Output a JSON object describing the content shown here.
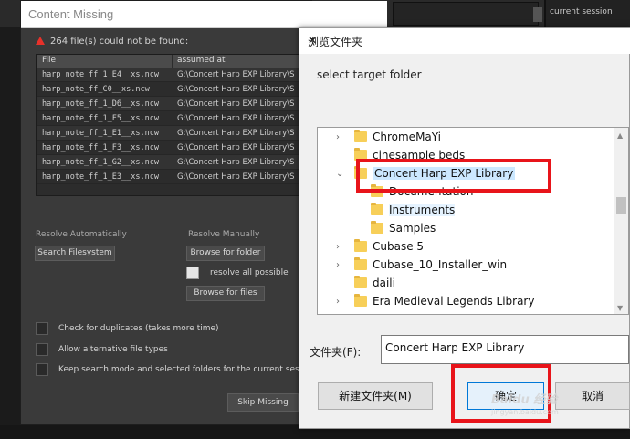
{
  "background": {
    "session_label": "current session"
  },
  "content_missing": {
    "title": "Content Missing",
    "alert_text": "264 file(s) could not be found:",
    "columns": [
      "File",
      "assumed at"
    ],
    "rows": [
      {
        "file": "harp_note_ff_1_E4__xs.ncw",
        "path": "G:\\Concert Harp EXP Library\\S"
      },
      {
        "file": "harp_note_ff_C0__xs.ncw",
        "path": "G:\\Concert Harp EXP Library\\S"
      },
      {
        "file": "harp_note_ff_1_D6__xs.ncw",
        "path": "G:\\Concert Harp EXP Library\\S"
      },
      {
        "file": "harp_note_ff_1_F5__xs.ncw",
        "path": "G:\\Concert Harp EXP Library\\S"
      },
      {
        "file": "harp_note_ff_1_E1__xs.ncw",
        "path": "G:\\Concert Harp EXP Library\\S"
      },
      {
        "file": "harp_note_ff_1_F3__xs.ncw",
        "path": "G:\\Concert Harp EXP Library\\S"
      },
      {
        "file": "harp_note_ff_1_G2__xs.ncw",
        "path": "G:\\Concert Harp EXP Library\\S"
      },
      {
        "file": "harp_note_ff_1_E3__xs.ncw",
        "path": "G:\\Concert Harp EXP Library\\S"
      }
    ],
    "resolve_auto_label": "Resolve Automatically",
    "resolve_manual_label": "Resolve Manually",
    "search_filesystem": "Search Filesystem",
    "browse_folder": "Browse for folder",
    "resolve_all": "resolve all possible",
    "browse_files": "Browse for files",
    "opt_duplicates": "Check for duplicates (takes more time)",
    "opt_alternative": "Allow alternative file types",
    "opt_keep": "Keep search mode and selected folders for the current session",
    "skip_missing": "Skip Missing"
  },
  "browse_folder_dialog": {
    "title": "浏览文件夹",
    "close": "✕",
    "prompt": "select target folder",
    "tree": [
      {
        "name": "ChromeMaYi",
        "expander": "›",
        "level": 0
      },
      {
        "name": "cinesample beds",
        "expander": "",
        "level": 0
      },
      {
        "name": "Concert Harp EXP Library",
        "expander": "⌄",
        "level": 0,
        "selected": true
      },
      {
        "name": "Documentation",
        "expander": "",
        "level": 1
      },
      {
        "name": "Instruments",
        "expander": "",
        "level": 1,
        "highlighted": true
      },
      {
        "name": "Samples",
        "expander": "",
        "level": 1
      },
      {
        "name": "Cubase 5",
        "expander": "›",
        "level": 0
      },
      {
        "name": "Cubase_10_Installer_win",
        "expander": "›",
        "level": 0
      },
      {
        "name": "daili",
        "expander": "",
        "level": 0
      },
      {
        "name": "Era Medieval Legends Library",
        "expander": "›",
        "level": 0
      }
    ],
    "folder_label": "文件夹(F):",
    "folder_value": "Concert Harp EXP Library",
    "new_folder": "新建文件夹(M)",
    "ok": "确定",
    "cancel": "取消"
  },
  "watermark": {
    "main": "Baidu 经验",
    "sub": "jingyan.baidu.com"
  }
}
